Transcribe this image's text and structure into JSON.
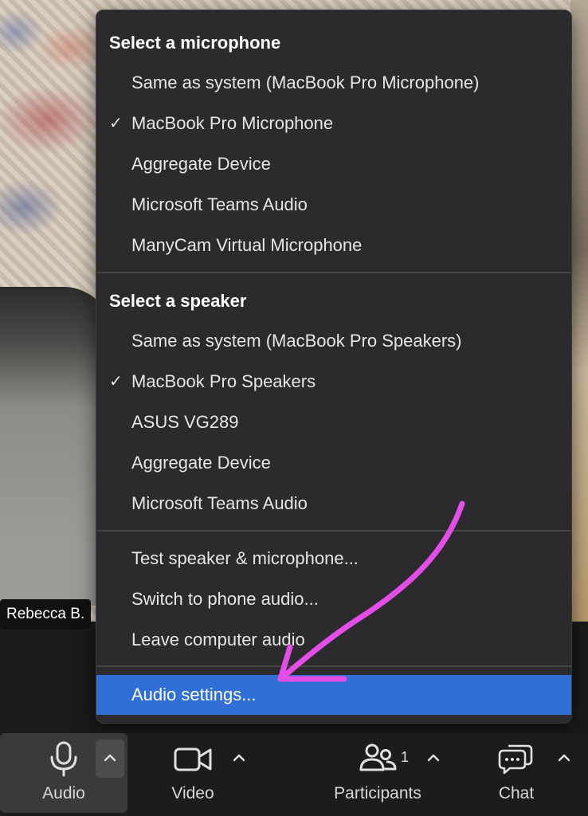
{
  "background": {
    "participant_name": "Rebecca B."
  },
  "menu": {
    "microphone_title": "Select a microphone",
    "microphones": [
      {
        "label": "Same as system (MacBook Pro Microphone)",
        "checked": false
      },
      {
        "label": "MacBook Pro Microphone",
        "checked": true
      },
      {
        "label": "Aggregate Device",
        "checked": false
      },
      {
        "label": "Microsoft Teams Audio",
        "checked": false
      },
      {
        "label": "ManyCam Virtual Microphone",
        "checked": false
      }
    ],
    "speaker_title": "Select a speaker",
    "speakers": [
      {
        "label": "Same as system (MacBook Pro Speakers)",
        "checked": false
      },
      {
        "label": "MacBook Pro Speakers",
        "checked": true
      },
      {
        "label": "ASUS VG289",
        "checked": false
      },
      {
        "label": "Aggregate Device",
        "checked": false
      },
      {
        "label": "Microsoft Teams Audio",
        "checked": false
      }
    ],
    "actions": [
      {
        "label": "Test speaker & microphone..."
      },
      {
        "label": "Switch to phone audio..."
      },
      {
        "label": "Leave computer audio"
      }
    ],
    "settings_label": "Audio settings...",
    "check_glyph": "✓"
  },
  "toolbar": {
    "audio_label": "Audio",
    "video_label": "Video",
    "participants_label": "Participants",
    "participants_count": "1",
    "chat_label": "Chat"
  },
  "colors": {
    "menu_bg": "#2b2b2d",
    "highlight": "#2f6fd6",
    "annotation_arrow": "#e44de8"
  },
  "icons": {
    "mic": "microphone-icon",
    "video": "video-camera-icon",
    "participants": "participants-icon",
    "chat": "chat-bubble-icon",
    "caret": "chevron-up-icon",
    "check": "checkmark-icon"
  }
}
